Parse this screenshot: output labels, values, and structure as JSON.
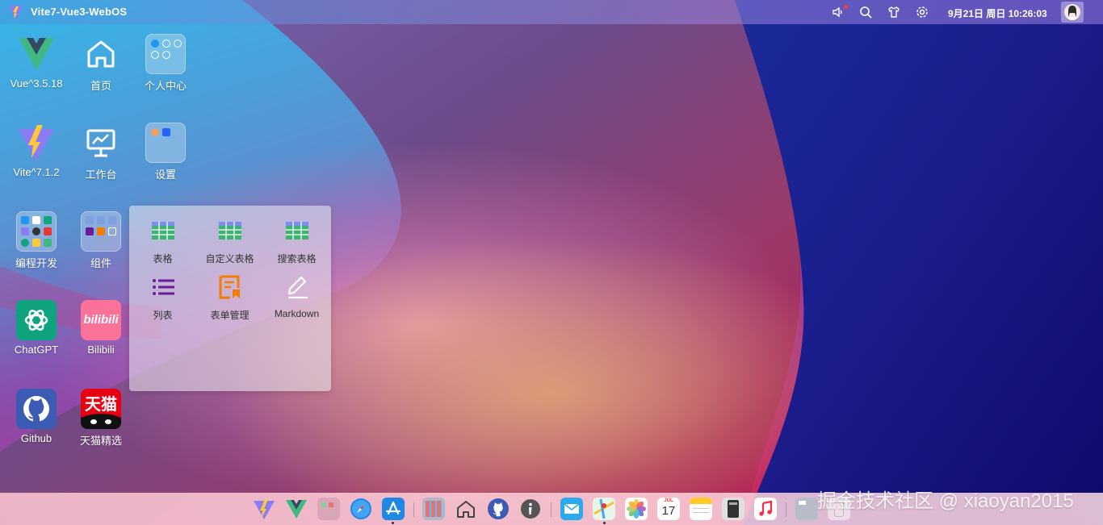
{
  "topbar": {
    "app_title": "Vite7-Vue3-WebOS",
    "datetime": "9月21日 周日 10:26:03",
    "icons": [
      "speaker-icon",
      "search-icon",
      "shirt-icon",
      "gear-icon"
    ]
  },
  "desktop": {
    "icons": [
      {
        "id": "vue",
        "label": "Vue^3.5.18"
      },
      {
        "id": "home",
        "label": "首页"
      },
      {
        "id": "profile",
        "label": "个人中心"
      },
      {
        "id": "vite",
        "label": "Vite^7.1.2"
      },
      {
        "id": "workbench",
        "label": "工作台"
      },
      {
        "id": "settings",
        "label": "设置"
      },
      {
        "id": "devtools",
        "label": "编程开发"
      },
      {
        "id": "components",
        "label": "组件"
      },
      {
        "id": "chatgpt",
        "label": "ChatGPT"
      },
      {
        "id": "bilibili",
        "label": "Bilibili"
      },
      {
        "id": "github",
        "label": "Github"
      },
      {
        "id": "tmall",
        "label": "天猫精选"
      }
    ]
  },
  "folder_popup": {
    "items": [
      {
        "label": "表格"
      },
      {
        "label": "自定义表格"
      },
      {
        "label": "搜索表格"
      },
      {
        "label": "列表"
      },
      {
        "label": "表单管理"
      },
      {
        "label": "Markdown"
      }
    ]
  },
  "icon_texts": {
    "bilibili": "bilibili",
    "tmall": "天猫",
    "calendar_day": "17",
    "calendar_month": "JUL"
  },
  "watermark": "掘金技术社区 @ xiaoyan2015",
  "colors": {
    "accent_blue": "#2196f3",
    "chatgpt_green": "#10a37f",
    "bilibili_pink": "#fb7299",
    "github_blue": "#3b5bb5",
    "tmall_red": "#e60012",
    "table_green": "#3cb371",
    "list_purple": "#6a1b9a",
    "form_orange": "#f57c00"
  }
}
